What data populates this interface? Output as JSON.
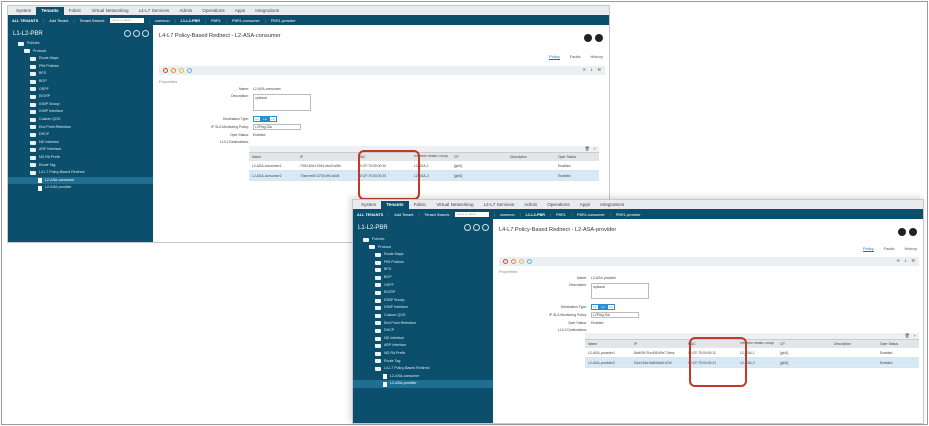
{
  "tabs": [
    "System",
    "Tenants",
    "Fabric",
    "Virtual Networking",
    "L4-L7 Services",
    "Admin",
    "Operations",
    "Apps",
    "Integrations"
  ],
  "active_tab": "Tenants",
  "subnav": {
    "all": "ALL TENANTS",
    "add": "Add Tenant",
    "search_label": "Tenant Search:",
    "search_placeholder": "name or descr",
    "crumbs": [
      "common",
      "L1-L2-PBR",
      "PBR1",
      "PBR1-consumer",
      "PBR1-provider"
    ]
  },
  "sidebar": {
    "title": "L1-L2-PBR",
    "items": [
      "Policies",
      "Protocol",
      "Route Maps",
      "PIM Policies",
      "BFD",
      "BGP",
      "OSPF",
      "EIGRP",
      "IGMP Snoop",
      "IGMP Interface",
      "Custom QOS",
      "End Point Retention",
      "DHCP",
      "ND Interface",
      "ARP Interface",
      "ND RA Prefix",
      "Route Tag",
      "L4-L7 Policy-Based Redirect"
    ]
  },
  "panel1": {
    "title": "L4-L7 Policy-Based Redirect - L2-ASA-consumer",
    "tabs": [
      "Policy",
      "Faults",
      "History"
    ],
    "properties": "Properties",
    "name_label": "Name:",
    "name": "L2-ASA-consumer",
    "desc_label": "Description:",
    "desc": "optional",
    "dest_label": "Destination Type:",
    "dest_opts": [
      "L1",
      "L2",
      "L3"
    ],
    "sla_label": "IP SLA Monitoring Policy:",
    "sla": "L2Ping-Sla",
    "oper_label": "Oper Status:",
    "oper": "Enabled",
    "dest_list_label": "L1/L2 Destinations:",
    "cols": [
      "Name",
      "IP",
      "MAC",
      "Redirect Health Group",
      "CP",
      "Description",
      "Oper Status"
    ],
    "rows": [
      [
        "L2-ASA-consumer1",
        "7000:40d1:92e1:ebe3:a0fd",
        "00:CF:75:00:00:10",
        "L2-ASA-1",
        "[gbl1]",
        "",
        "Enabled"
      ],
      [
        "L2-ASA-consumer2",
        "70ae:ee80:3703:cff4:a0d5",
        "00:CF:75:00:00:20",
        "L2-ASA-2",
        "[gbl1]",
        "",
        "Enabled"
      ]
    ],
    "leaf1": "L2-ASA-consumer",
    "leaf2": "L2-ASA-provider"
  },
  "panel2": {
    "title": "L4-L7 Policy-Based Redirect - L2-ASA-provider",
    "tabs": [
      "Policy",
      "Faults",
      "History"
    ],
    "properties": "Properties",
    "name_label": "Name:",
    "name": "L2-ASA-provider",
    "desc_label": "Description:",
    "desc": "optional",
    "dest_label": "Destination Type:",
    "dest_opts": [
      "L1",
      "L2",
      "L3"
    ],
    "sla_label": "IP SLA Monitoring Policy:",
    "sla": "L2Ping-Sla",
    "oper_label": "Oper Status:",
    "oper": "Enabled",
    "dest_list_label": "L1/L2 Destinations:",
    "cols": [
      "Name",
      "IP",
      "MAC",
      "Redirect Health Group",
      "CP",
      "Description",
      "Oper Status"
    ],
    "rows": [
      [
        "L2-ASA-provider1",
        "8ddf:2b79:e408:49e7:3eca",
        "00:CF:75:00:00:11",
        "L2-ASA-1",
        "[gbl1]",
        "",
        "Enabled"
      ],
      [
        "L2-ASA-provider2",
        "f11e:f43a:9d4f:b8a5:d7fd",
        "00:CF:75:00:00:21",
        "L2-ASA-2",
        "[gbl1]",
        "",
        "Enabled"
      ]
    ],
    "leaf1": "L2-ASA-consumer",
    "leaf2": "L2-ASA-provider"
  },
  "colors": {
    "nav": "#0b4f6c",
    "highlight": "#c0392b",
    "accent": "#2a8fd0"
  }
}
